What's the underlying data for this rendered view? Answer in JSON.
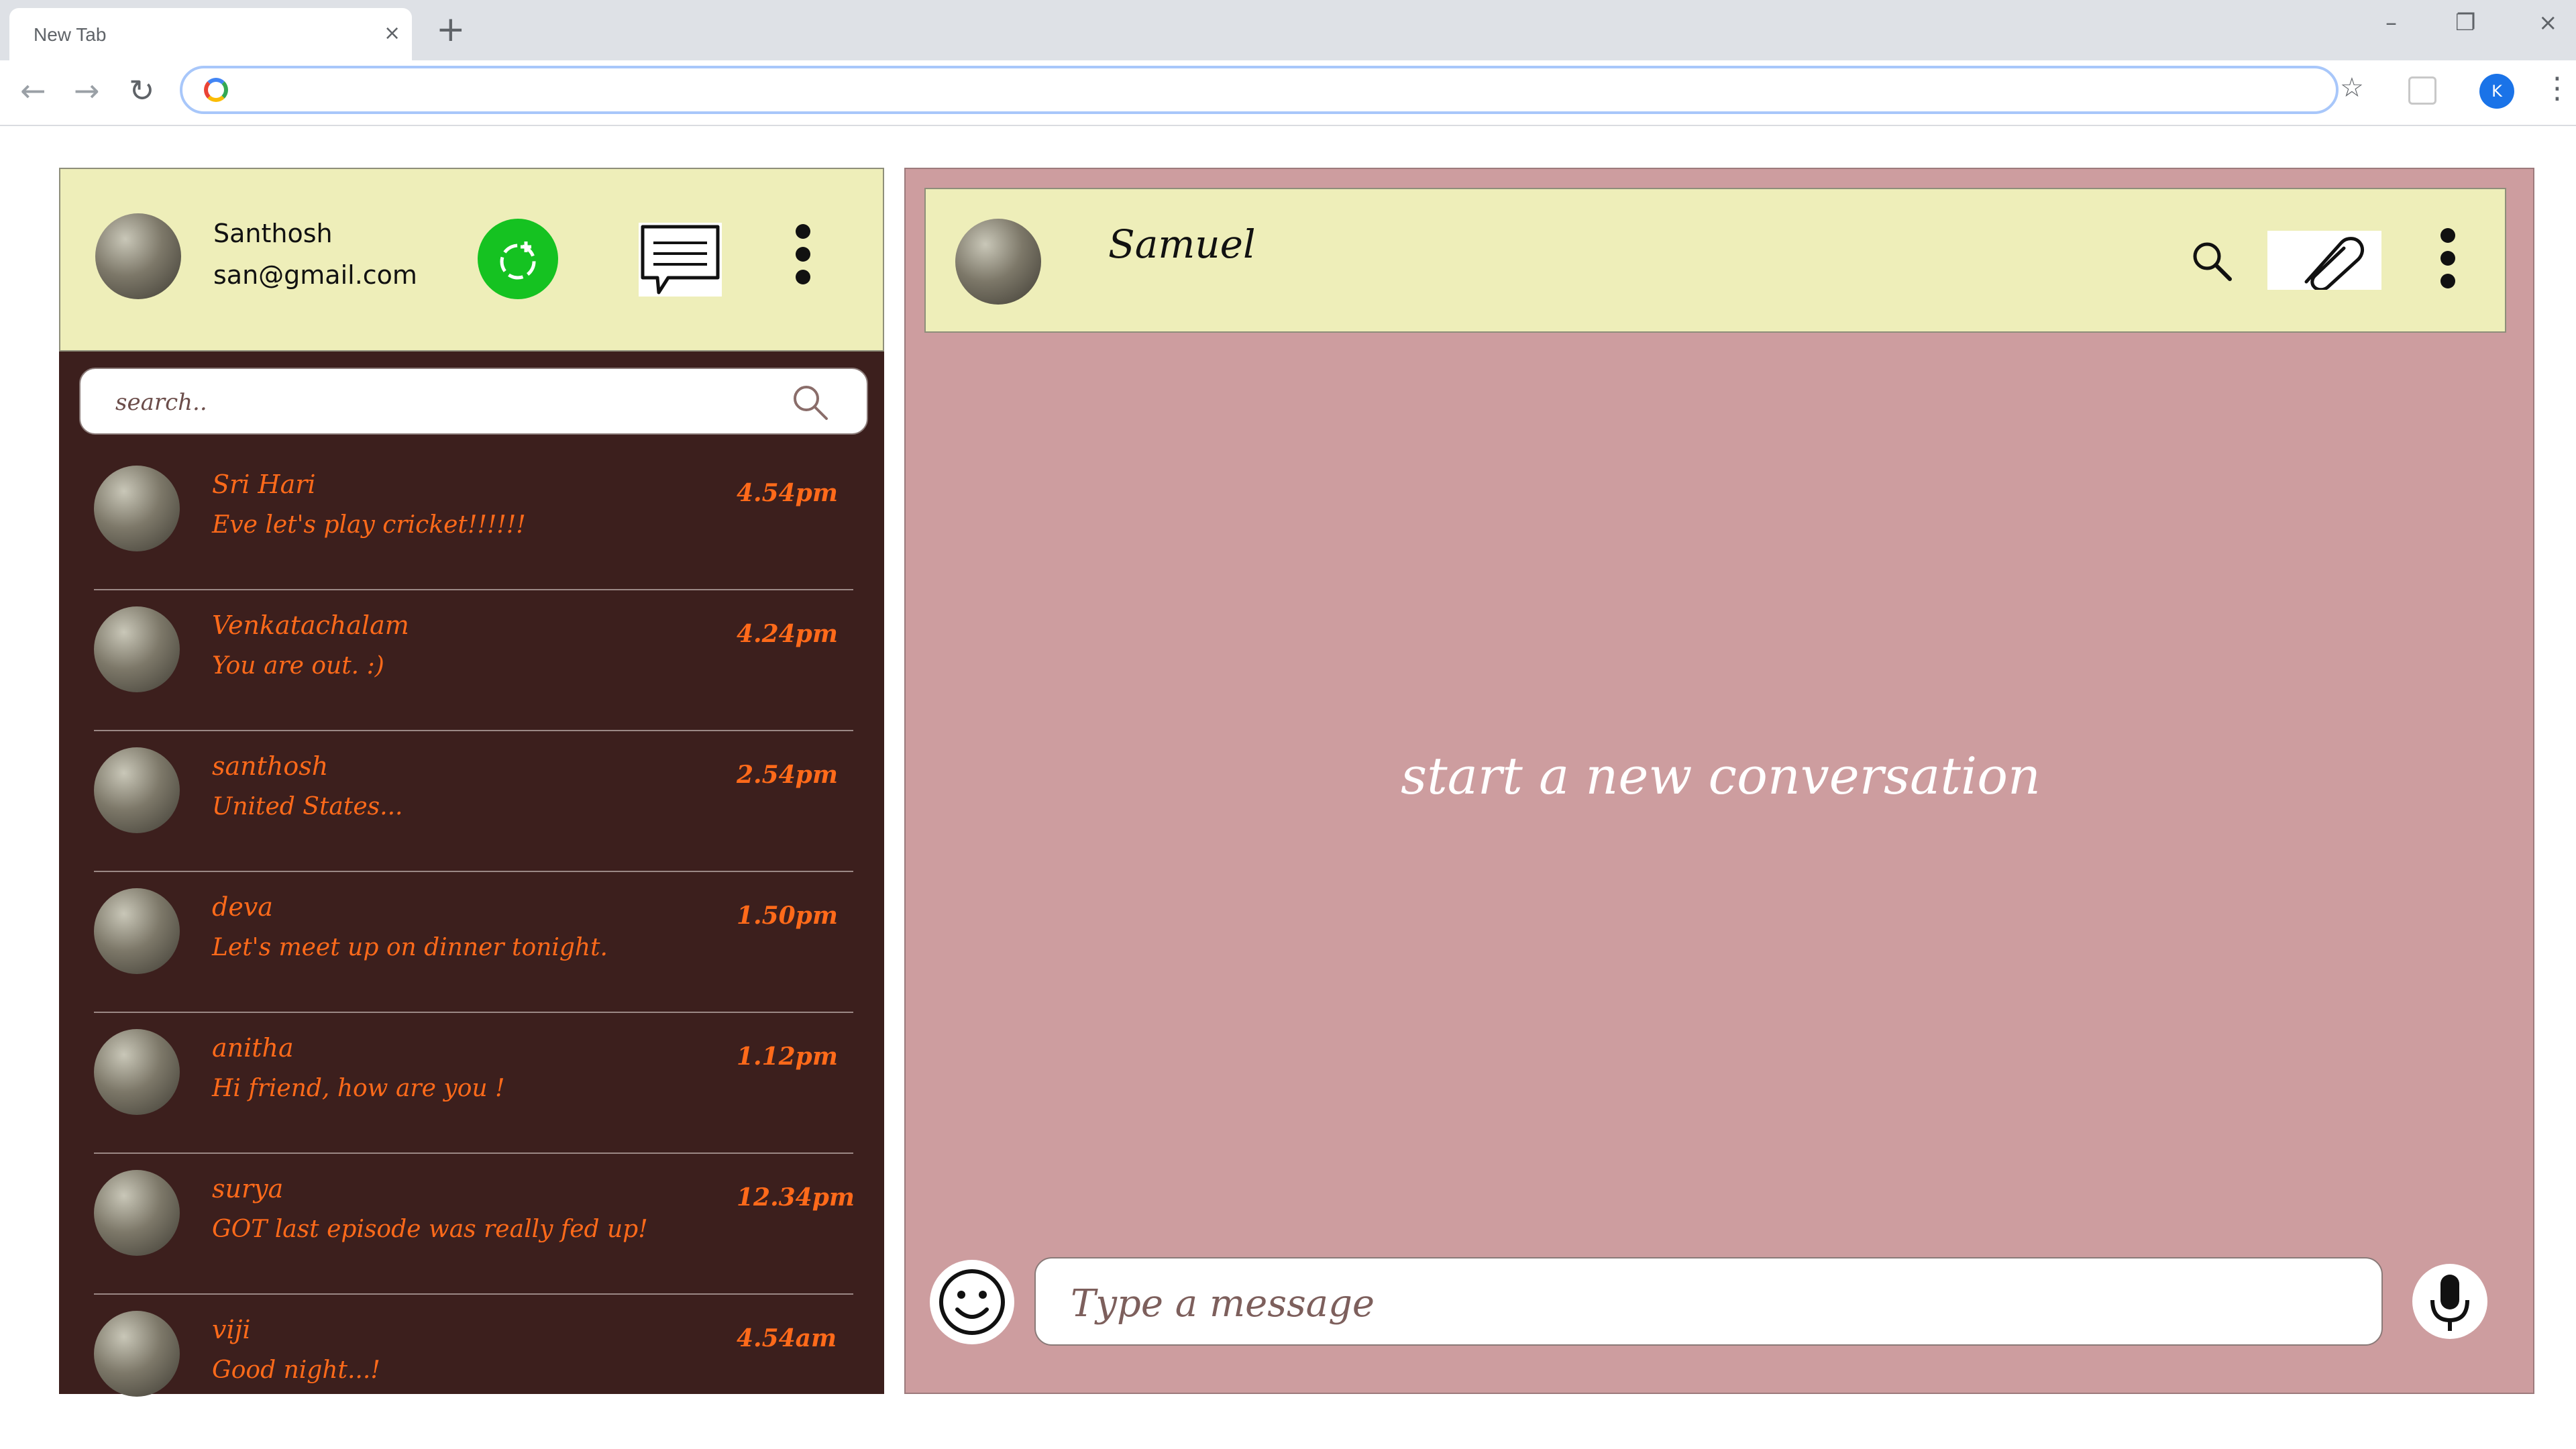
{
  "browser": {
    "tab_title": "New Tab",
    "tab_close_glyph": "×",
    "new_tab_glyph": "+",
    "minimize_glyph": "–",
    "restore_glyph": "❐",
    "close_glyph": "×",
    "back_glyph": "←",
    "forward_glyph": "→",
    "reload_glyph": "↻",
    "star_glyph": "☆",
    "profile_initial": "K",
    "menu_glyph": "⋮",
    "address_value": ""
  },
  "me": {
    "name": "Santhosh",
    "email": "san@gmail.com"
  },
  "search": {
    "placeholder": "search.."
  },
  "contacts": [
    {
      "name": "Sri Hari",
      "message": "Eve let's play cricket!!!!!!",
      "time": "4.54pm"
    },
    {
      "name": "Venkatachalam",
      "message": "You are out. :)",
      "time": "4.24pm"
    },
    {
      "name": "santhosh",
      "message": "United States...",
      "time": "2.54pm"
    },
    {
      "name": "deva",
      "message": "Let's meet up on dinner tonight.",
      "time": "1.50pm"
    },
    {
      "name": "anitha",
      "message": "Hi friend, how are you !",
      "time": "1.12pm"
    },
    {
      "name": "surya",
      "message": "GOT last episode was really fed up!",
      "time": "12.34pm"
    },
    {
      "name": "viji",
      "message": "Good night...!",
      "time": "4.54am"
    }
  ],
  "chat": {
    "peer_name": "Samuel",
    "empty_state": "start a new conversation",
    "message_placeholder": "Type a message"
  },
  "icons": {
    "status": "status-icon",
    "new_chat": "new-chat-icon",
    "menu": "vertical-dots-icon",
    "search": "search-icon",
    "attach": "paperclip-icon",
    "emoji": "smiley-icon",
    "mic": "microphone-icon"
  },
  "colors": {
    "header_bg": "#eeeeb9",
    "sidebar_bg": "#3c1f1d",
    "chat_bg": "#cd9d9f",
    "accent_text": "#ff6a1a",
    "status_green": "#15c221"
  }
}
